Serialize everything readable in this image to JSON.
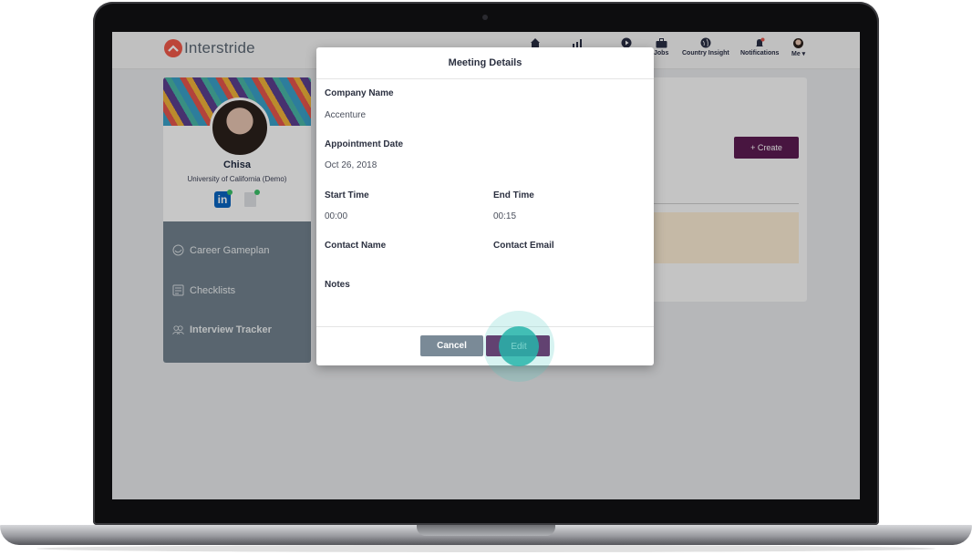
{
  "app": {
    "logo_text": "Interstride",
    "nav": [
      {
        "label": "",
        "icon": "home-icon"
      },
      {
        "label": "",
        "icon": "chart-icon"
      },
      {
        "label": "",
        "icon": "play-icon"
      },
      {
        "label": "Jobs",
        "icon": "briefcase-icon"
      },
      {
        "label": "Country Insight",
        "icon": "globe-icon"
      },
      {
        "label": "Notifications",
        "icon": "bell-icon"
      },
      {
        "label": "Me ▾",
        "icon": "avatar-icon"
      }
    ]
  },
  "profile": {
    "name": "Chisa",
    "university": "University of California (Demo)",
    "menu": [
      {
        "label": "Career Gameplan",
        "icon": "gameplan-icon"
      },
      {
        "label": "Checklists",
        "icon": "checklist-icon"
      },
      {
        "label": "Interview Tracker",
        "icon": "people-icon"
      }
    ]
  },
  "main": {
    "create_label": "+ Create"
  },
  "modal": {
    "title": "Meeting Details",
    "company_label": "Company Name",
    "company_value": "Accenture",
    "date_label": "Appointment Date",
    "date_value": "Oct 26, 2018",
    "start_label": "Start Time",
    "start_value": "00:00",
    "end_label": "End Time",
    "end_value": "00:15",
    "contact_name_label": "Contact Name",
    "contact_email_label": "Contact Email",
    "notes_label": "Notes",
    "cancel_label": "Cancel",
    "edit_label": "Edit"
  },
  "colors": {
    "accent": "#5d1c52",
    "cancel": "#7a8a97",
    "tap_highlight": "#28b4aa"
  }
}
